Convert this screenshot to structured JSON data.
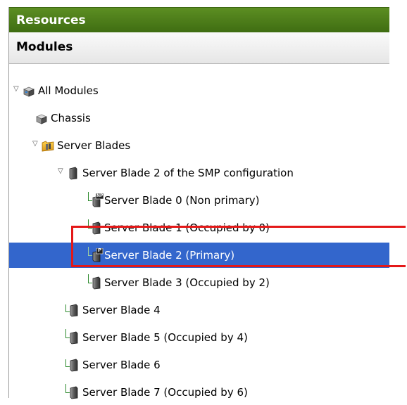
{
  "panel": {
    "resources_title": "Resources",
    "modules_title": "Modules"
  },
  "tree": {
    "all_modules": "All Modules",
    "chassis": "Chassis",
    "server_blades": "Server Blades",
    "smp_config": "Server Blade 2 of the SMP configuration",
    "blade0": "Server Blade 0 (Non primary)",
    "blade1": "Server Blade 1 (Occupied by 0)",
    "blade2": "Server Blade 2 (Primary)",
    "blade3": "Server Blade 3 (Occupied by 2)",
    "blade4": "Server Blade 4",
    "blade5": "Server Blade 5 (Occupied by 4)",
    "blade6": "Server Blade 6",
    "blade7": "Server Blade 7 (Occupied by 6)"
  },
  "badges": {
    "non_primary": "NP",
    "primary": "P"
  },
  "colors": {
    "header_green": "#4a7a18",
    "selection_blue": "#3366cc",
    "highlight_red": "#e41818"
  },
  "icons": {
    "modules": "modules-icon",
    "chassis": "chassis-icon",
    "folder": "folder-icon",
    "blade": "server-blade-icon"
  }
}
